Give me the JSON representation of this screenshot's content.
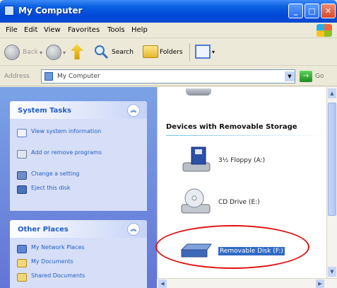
{
  "window": {
    "title": "My Computer",
    "controls": {
      "minimize": "_",
      "maximize": "□",
      "close": "✕"
    }
  },
  "menu": {
    "items": [
      "File",
      "Edit",
      "View",
      "Favorites",
      "Tools",
      "Help"
    ]
  },
  "toolbar": {
    "back_label": "Back",
    "search_label": "Search",
    "folders_label": "Folders"
  },
  "address": {
    "label": "Address",
    "value": "My Computer",
    "go_label": "Go"
  },
  "task_pane": {
    "system_tasks": {
      "title": "System Tasks",
      "items": [
        {
          "label": "View system information",
          "icon": "info-icon"
        },
        {
          "label": "Add or remove programs",
          "icon": "programs-icon"
        },
        {
          "label": "Change a setting",
          "icon": "control-panel-icon"
        },
        {
          "label": "Eject this disk",
          "icon": "eject-icon"
        }
      ]
    },
    "other_places": {
      "title": "Other Places",
      "items": [
        {
          "label": "My Network Places",
          "icon": "network-icon"
        },
        {
          "label": "My Documents",
          "icon": "documents-icon"
        },
        {
          "label": "Shared Documents",
          "icon": "shared-folder-icon"
        }
      ]
    }
  },
  "content": {
    "group_title": "Devices with Removable Storage",
    "drives": [
      {
        "label": "3½ Floppy (A:)",
        "icon": "floppy-drive-icon"
      },
      {
        "label": "CD Drive (E:)",
        "icon": "cd-drive-icon"
      },
      {
        "label": "Removable Disk (F:)",
        "icon": "removable-disk-icon",
        "selected": true
      }
    ]
  },
  "colors": {
    "title_bar": "#0047d8",
    "task_pane": "#6375d6",
    "link": "#215dc6",
    "selection": "#316ac5",
    "annotation": "#e01010"
  }
}
